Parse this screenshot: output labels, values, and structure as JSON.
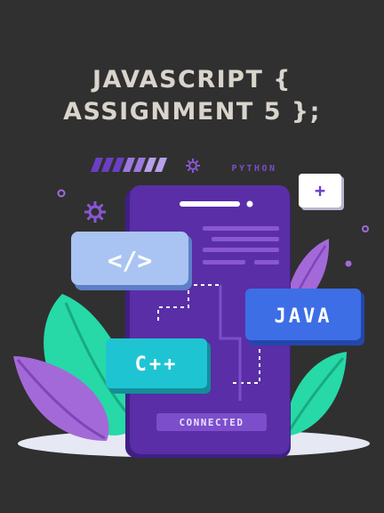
{
  "title": {
    "line1": "JAVASCRIPT {",
    "line2": "ASSIGNMENT 5 };"
  },
  "tags": {
    "python": "PYTHON",
    "java": "JAVA",
    "cpp": "C++",
    "html": "</>",
    "plus": "+",
    "connected": "CONNECTED"
  },
  "colors": {
    "background": "#303030",
    "title": "#d9d4cc",
    "phone": "#5a2ea6",
    "java_card": "#3d6ee6",
    "cpp_card": "#1fc4d2",
    "html_card": "#a9c4f2",
    "leaf_teal": "#26d9a6",
    "leaf_purple": "#a469d8"
  }
}
